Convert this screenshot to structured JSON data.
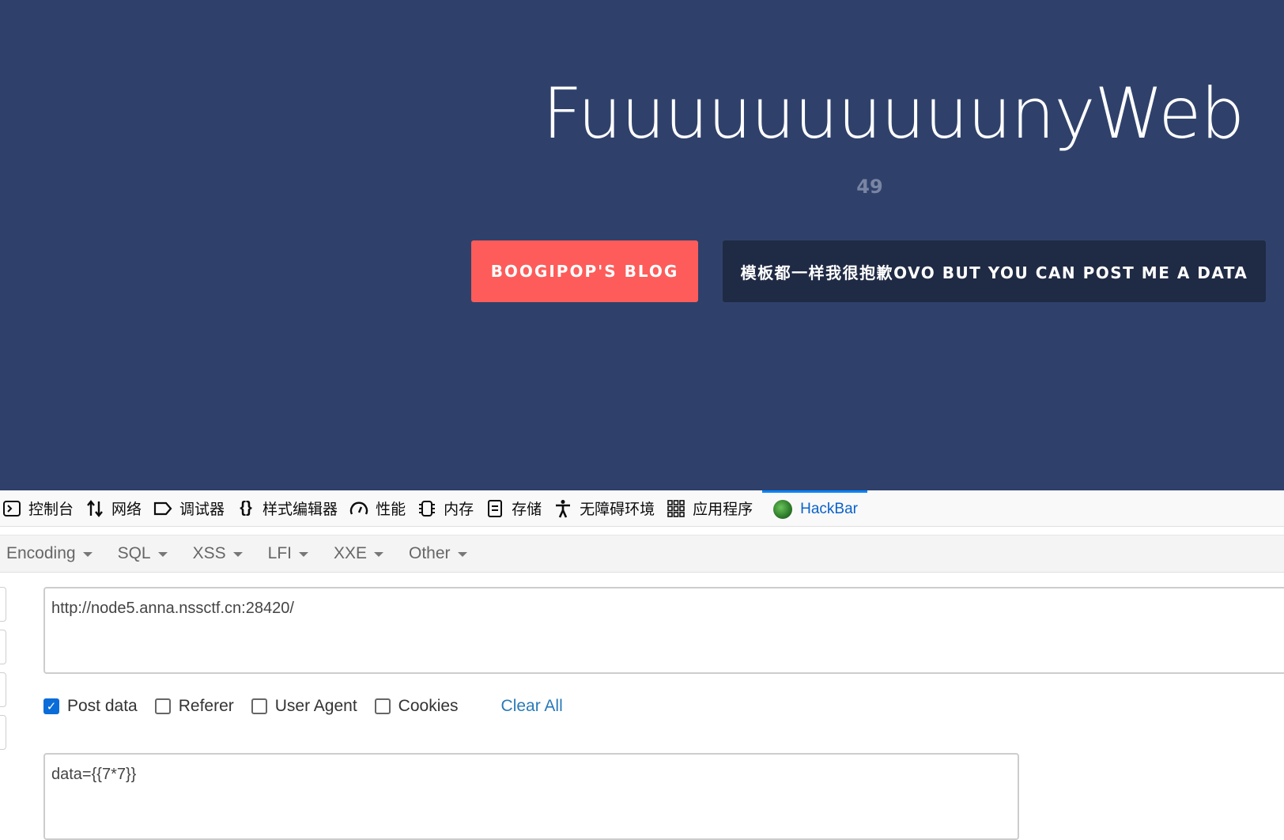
{
  "hero": {
    "title": "FuuuuuuuuuunyWeb",
    "subtitle": "49",
    "buttons": {
      "blog": "BOOGIPOP'S BLOG",
      "data": "模板都一样我很抱歉OVO BUT YOU CAN POST ME A DATA"
    },
    "colors": {
      "background": "#2f416b",
      "blog_button": "#fd5c5a",
      "data_button": "#1f2a44"
    }
  },
  "devtools": {
    "tabs": [
      {
        "label": "控制台",
        "icon": "console-icon"
      },
      {
        "label": "网络",
        "icon": "network-arrows-icon"
      },
      {
        "label": "调试器",
        "icon": "debugger-icon"
      },
      {
        "label": "样式编辑器",
        "icon": "braces-icon"
      },
      {
        "label": "性能",
        "icon": "gauge-icon"
      },
      {
        "label": "内存",
        "icon": "memory-chip-icon"
      },
      {
        "label": "存储",
        "icon": "storage-icon"
      },
      {
        "label": "无障碍环境",
        "icon": "accessibility-icon"
      },
      {
        "label": "应用程序",
        "icon": "grid-apps-icon"
      },
      {
        "label": "HackBar",
        "icon": "hackbar-logo-icon",
        "active": true
      }
    ]
  },
  "hackbar": {
    "menu": [
      "Encoding",
      "SQL",
      "XSS",
      "LFI",
      "XXE",
      "Other"
    ],
    "url": "http://node5.anna.nssctf.cn:28420/",
    "options": [
      {
        "label": "Post data",
        "checked": true
      },
      {
        "label": "Referer",
        "checked": false
      },
      {
        "label": "User Agent",
        "checked": false
      },
      {
        "label": "Cookies",
        "checked": false
      }
    ],
    "clear_all": "Clear All",
    "post_data": "data={{7*7}}"
  }
}
